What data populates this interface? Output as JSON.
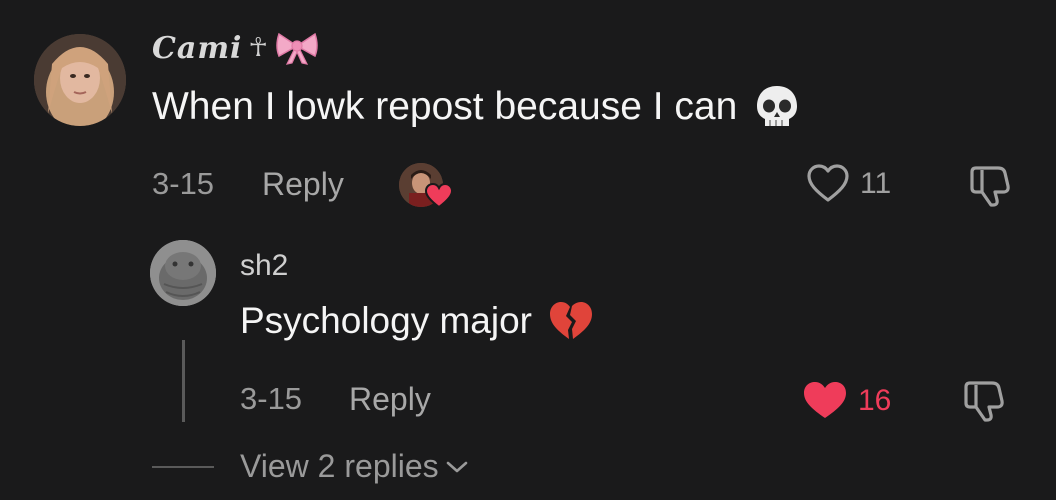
{
  "comment": {
    "username": "Cami",
    "username_symbols": "☥",
    "text": "When I lowk repost because I can",
    "date": "3-15",
    "reply_label": "Reply",
    "like_count": "11"
  },
  "reply_comment": {
    "username": "sh2",
    "text": "Psychology major",
    "date": "3-15",
    "reply_label": "Reply",
    "like_count": "16"
  },
  "view_replies_label": "View 2 replies",
  "icons": {
    "bow": "pink-bow-emoji",
    "skull": "skull-emoji",
    "broken_heart": "broken-heart-emoji",
    "heart_outline": "heart-outline-icon",
    "heart_filled": "heart-filled-icon",
    "dislike": "thumbs-down-icon",
    "chevron": "chevron-down-icon"
  },
  "colors": {
    "background": "#1a1a1b",
    "liked_red": "#ef3c5a",
    "muted_text": "#9a9a9a"
  }
}
